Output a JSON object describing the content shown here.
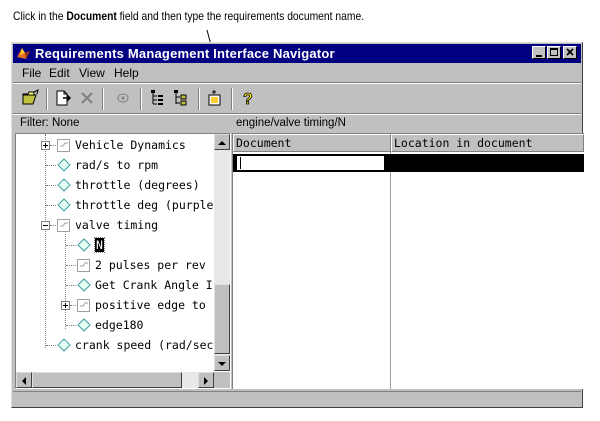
{
  "callout": {
    "before": "Click in the ",
    "bold": "Document",
    "after": " field and then type the requirements document name."
  },
  "window": {
    "title": "Requirements Management Interface Navigator",
    "controls": [
      "minimize",
      "maximize",
      "close"
    ]
  },
  "menu": [
    "File",
    "Edit",
    "View",
    "Help"
  ],
  "toolbar": {
    "icons": [
      "open-folder-icon",
      "new-link-icon",
      "delete-icon",
      "view-icon",
      "expand-tree-icon",
      "collapse-tree-icon",
      "new-item-icon",
      "help-icon"
    ]
  },
  "filter": {
    "label": "Filter: None"
  },
  "path": {
    "label": "engine/valve timing/N"
  },
  "tree": {
    "items": [
      {
        "label": "Vehicle Dynamics",
        "icon": "subsystem-icon",
        "expander": "plus"
      },
      {
        "label": "rad/s to rpm",
        "icon": "block-icon"
      },
      {
        "label": "throttle (degrees)",
        "icon": "block-icon"
      },
      {
        "label": "throttle deg (purple",
        "icon": "block-icon"
      },
      {
        "label": "valve timing",
        "icon": "subsystem-icon",
        "expander": "minus"
      },
      {
        "label": "N",
        "icon": "block-icon",
        "selected": true
      },
      {
        "label": "2 pulses per rev",
        "icon": "subsystem-icon"
      },
      {
        "label": "Get Crank Angle I",
        "icon": "block-icon"
      },
      {
        "label": "positive edge to",
        "icon": "subsystem-icon",
        "expander": "plus"
      },
      {
        "label": "edge180",
        "icon": "block-icon"
      },
      {
        "label": "crank speed (rad/sec",
        "icon": "block-icon"
      }
    ]
  },
  "grid": {
    "columns": [
      "Document",
      "Location in document"
    ],
    "document_value": ""
  }
}
